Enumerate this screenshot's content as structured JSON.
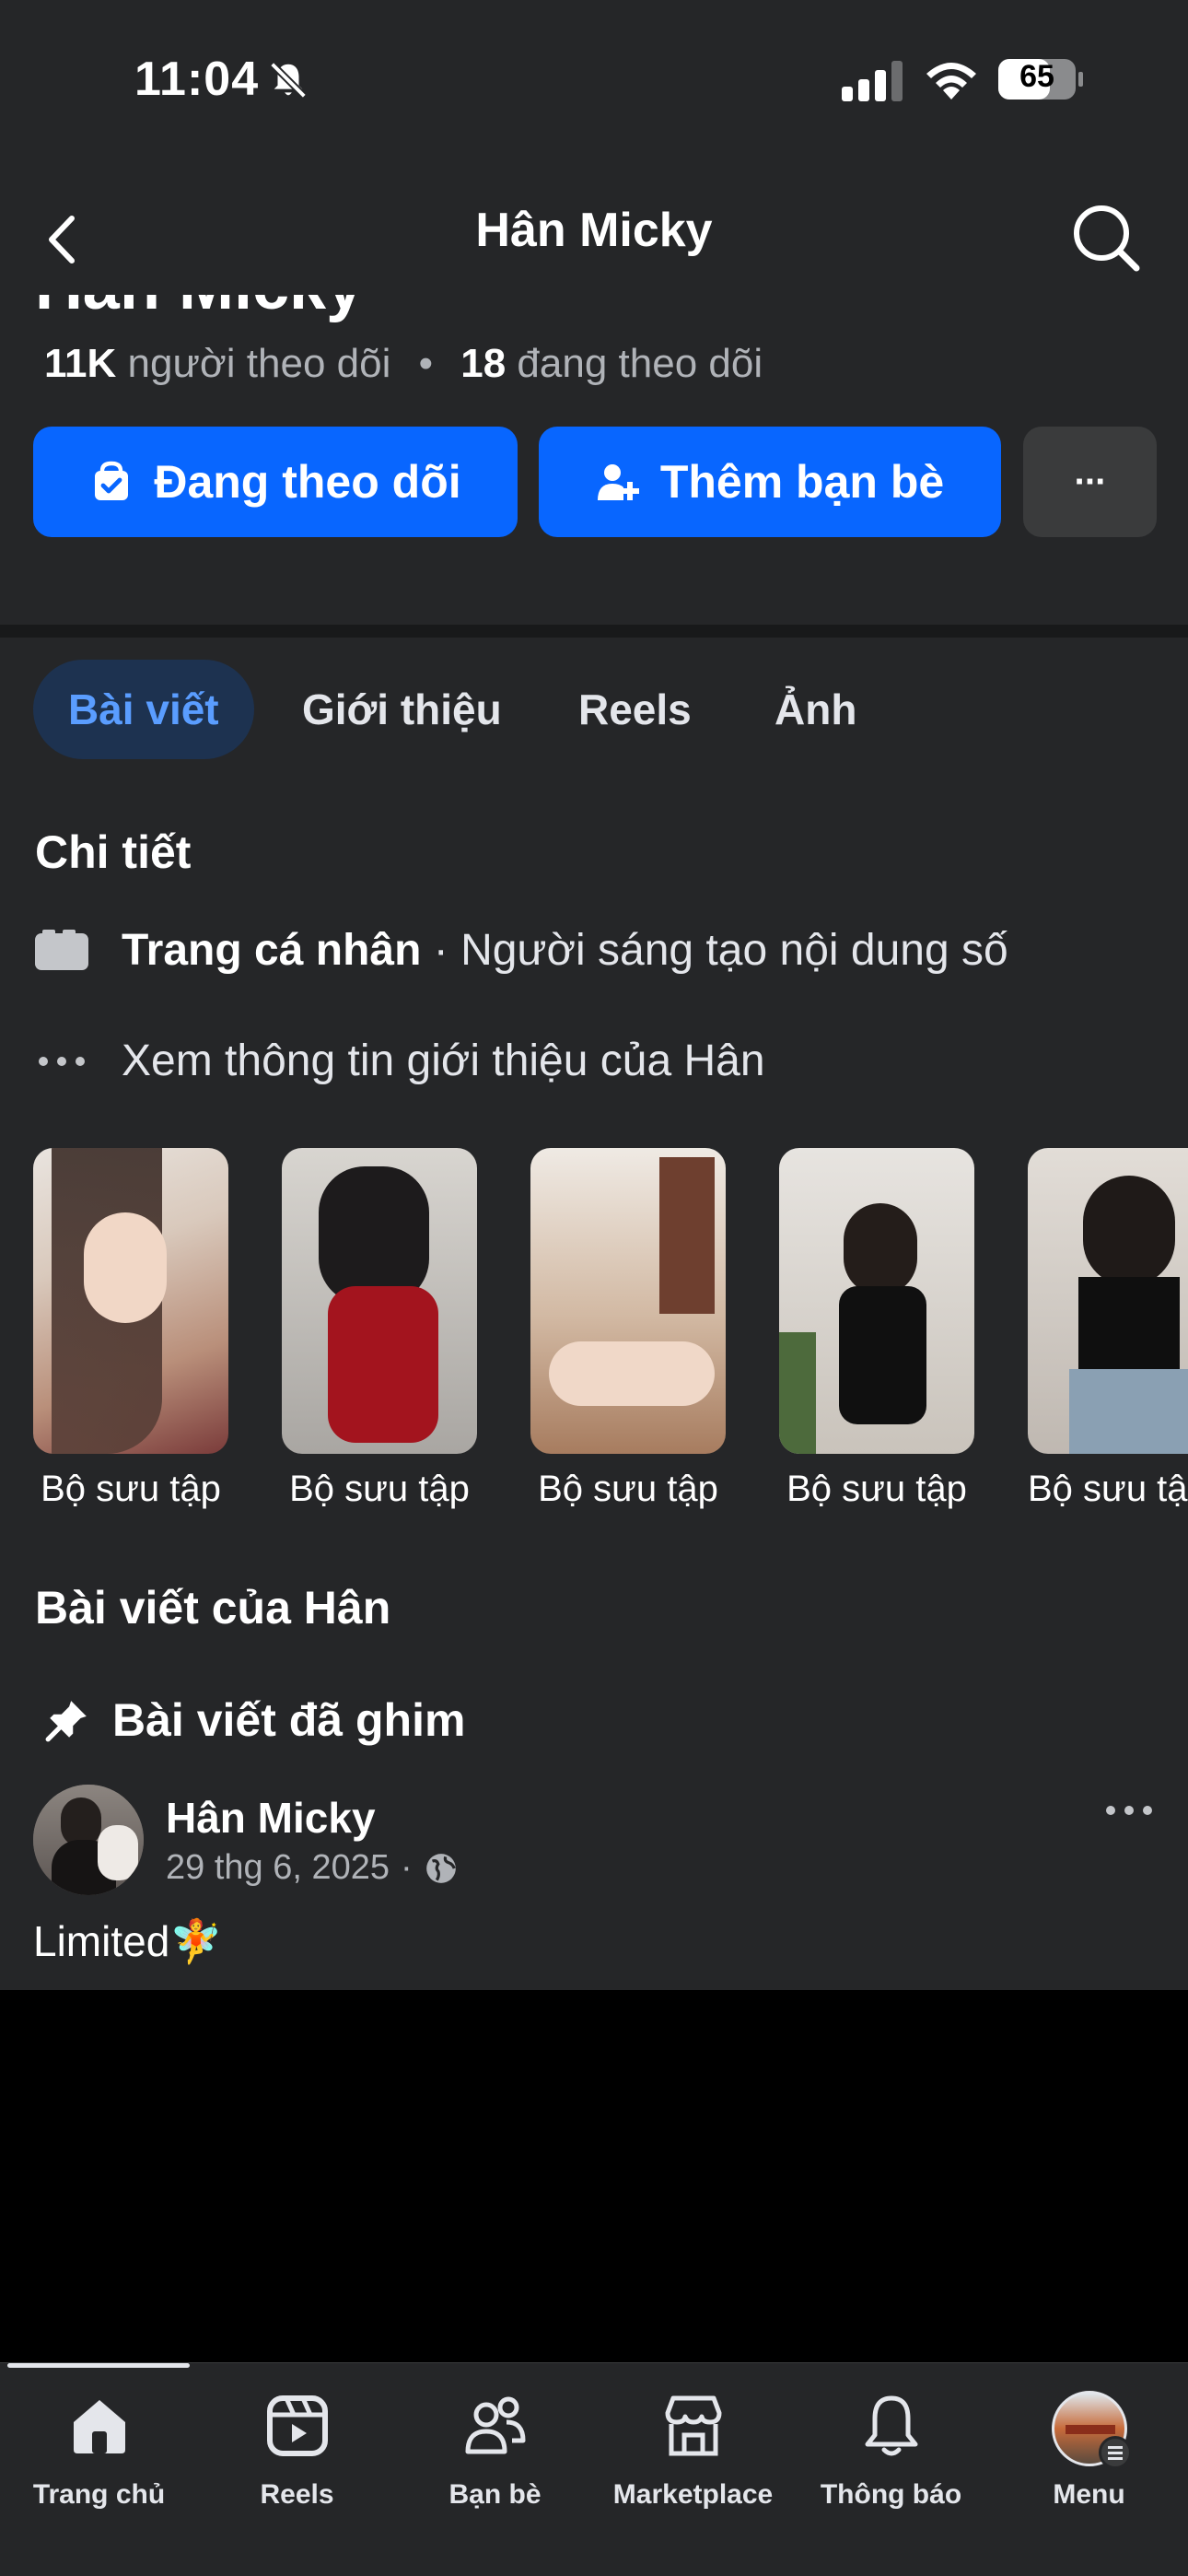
{
  "status_bar": {
    "time": "11:04",
    "battery": "65"
  },
  "header": {
    "title": "Hân Micky",
    "partial_name": "Hân Micky"
  },
  "profile": {
    "followers_count": "11K",
    "followers_label": "người theo dõi",
    "separator": "•",
    "following_count": "18",
    "following_label": "đang theo dõi"
  },
  "actions": {
    "following_label": "Đang theo dõi",
    "add_friend_label": "Thêm bạn bè",
    "more_label": "···"
  },
  "tabs": [
    {
      "label": "Bài viết",
      "active": true
    },
    {
      "label": "Giới thiệu",
      "active": false
    },
    {
      "label": "Reels",
      "active": false
    },
    {
      "label": "Ảnh",
      "active": false
    }
  ],
  "details": {
    "title": "Chi tiết",
    "page_type_bold": "Trang cá nhân",
    "page_type_rest": " · Người sáng tạo nội dung số",
    "see_about": "Xem thông tin giới thiệu của Hân"
  },
  "collections": [
    {
      "label": "Bộ sưu tập"
    },
    {
      "label": "Bộ sưu tập"
    },
    {
      "label": "Bộ sưu tập"
    },
    {
      "label": "Bộ sưu tập"
    },
    {
      "label": "Bộ sưu tập"
    }
  ],
  "posts_section": {
    "title": "Bài viết của Hân",
    "pinned_label": "Bài viết đã ghim"
  },
  "post": {
    "author": "Hân Micky",
    "date": "29 thg 6, 2025",
    "dot": "·",
    "text": "Limited",
    "emoji": "🧚"
  },
  "bottom_nav": [
    {
      "label": "Trang chủ",
      "icon": "home-icon",
      "active": true
    },
    {
      "label": "Reels",
      "icon": "reels-icon",
      "active": false
    },
    {
      "label": "Bạn bè",
      "icon": "friends-icon",
      "active": false
    },
    {
      "label": "Marketplace",
      "icon": "marketplace-icon",
      "active": false
    },
    {
      "label": "Thông báo",
      "icon": "bell-icon",
      "active": false
    },
    {
      "label": "Menu",
      "icon": "profile-avatar-icon",
      "active": false
    }
  ],
  "colors": {
    "background": "#252628",
    "accent": "#0866ff",
    "active_tab_bg": "#1d3250",
    "active_tab_text": "#5a9dff",
    "secondary_text": "#b0b3b8"
  }
}
